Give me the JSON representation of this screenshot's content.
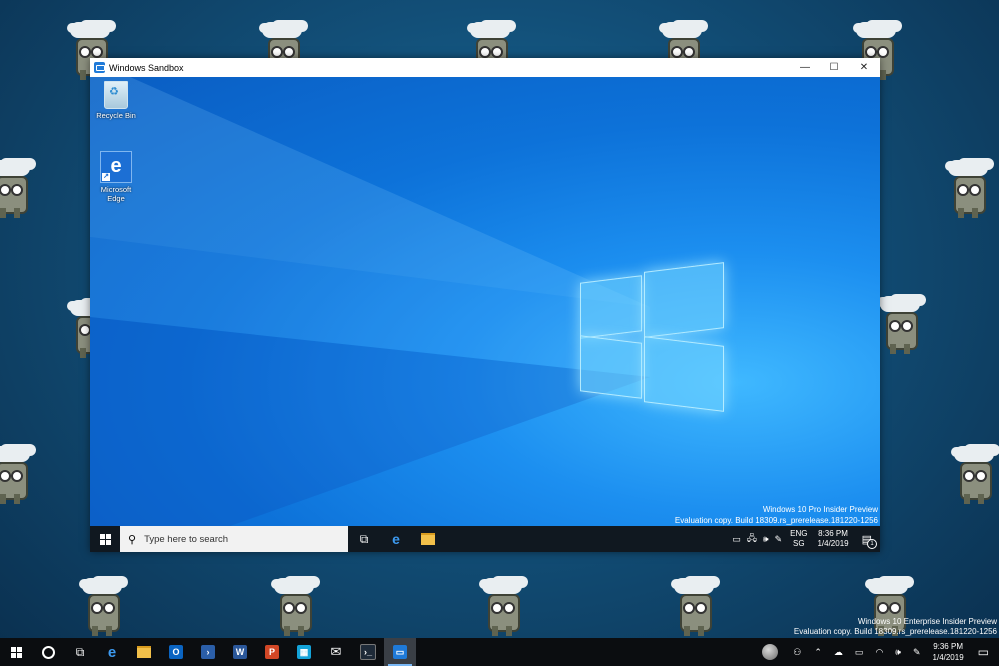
{
  "sandbox_window": {
    "title": "Windows Sandbox",
    "controls": {
      "minimize": "—",
      "maximize": "☐",
      "close": "✕"
    },
    "desktop_icons": [
      {
        "label": "Recycle Bin",
        "icon": "recycle-bin-icon"
      },
      {
        "label": "Microsoft Edge",
        "icon": "edge-icon"
      }
    ],
    "watermark": {
      "line1": "Windows 10 Pro Insider Preview",
      "line2": "Evaluation copy. Build 18309.rs_prerelease.181220-1256"
    },
    "taskbar": {
      "search_placeholder": "Type here to search",
      "tray_lang_1": "ENG",
      "tray_lang_2": "SG",
      "time": "8:36 PM",
      "date": "1/4/2019",
      "notification_count": "1"
    }
  },
  "host": {
    "watermark": {
      "line1": "Windows 10 Enterprise Insider Preview",
      "line2": "Evaluation copy. Build 18309.rs_prerelease.181220-1256"
    },
    "taskbar": {
      "time": "9:36 PM",
      "date": "1/4/2019",
      "apps": [
        "edge-icon",
        "file-explorer-icon",
        "outlook-icon",
        "powershell-icon",
        "word-icon",
        "powerpoint-icon",
        "store-icon",
        "mail-icon",
        "terminal-icon",
        "sandbox-icon"
      ]
    }
  },
  "colors": {
    "sandbox_desktop": "#0d72d9",
    "taskbar": "#101820",
    "host_background": "#124f78"
  }
}
